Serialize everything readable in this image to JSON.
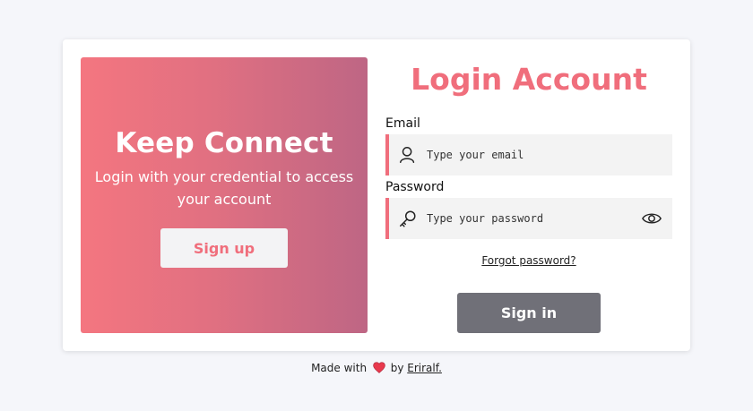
{
  "promo": {
    "title": "Keep Connect",
    "text": "Login with your credential to access your account",
    "signup_label": "Sign up"
  },
  "login": {
    "title": "Login Account",
    "email_label": "Email",
    "email_placeholder": "Type your email",
    "password_label": "Password",
    "password_placeholder": "Type your password",
    "forgot_label": "Forgot password?",
    "signin_label": "Sign in"
  },
  "footer": {
    "made_with": "Made with",
    "by": "by",
    "author": "Eriralf."
  },
  "colors": {
    "accent": "#f06e7c",
    "gradient_start": "#f47680",
    "gradient_end": "#be6684",
    "signin_button": "#707078",
    "page_bg": "#f5f6fa"
  },
  "icons": {
    "email_field": "user-icon",
    "password_field": "key-icon",
    "password_toggle": "eye-icon",
    "footer": "heart-icon"
  }
}
